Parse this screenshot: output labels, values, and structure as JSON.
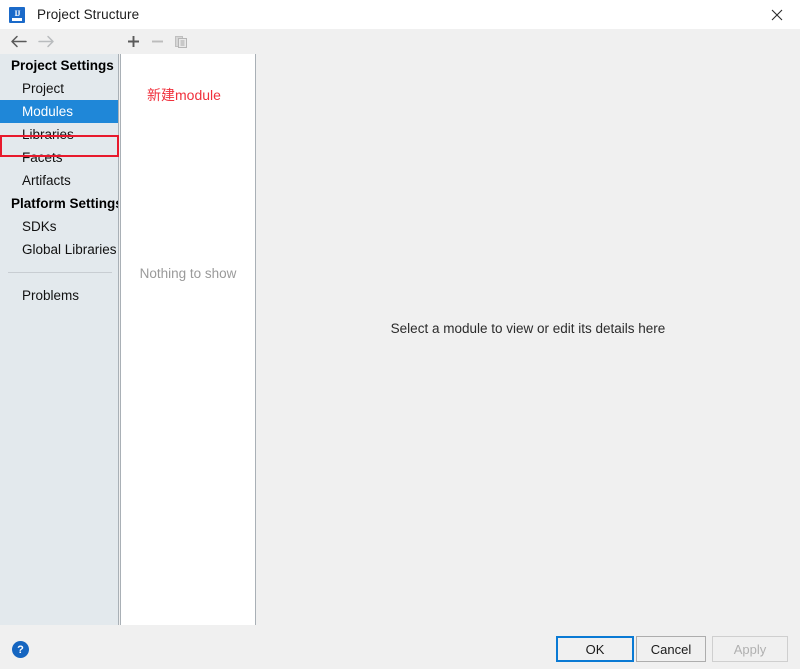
{
  "window": {
    "title": "Project Structure",
    "app_icon": "intellij-idea-icon",
    "close_label": "✕"
  },
  "navigation": {
    "back_icon": "arrow-left-icon",
    "forward_icon": "arrow-right-icon"
  },
  "sidebar": {
    "groups": [
      {
        "title": "Project Settings",
        "items": [
          {
            "label": "Project",
            "selected": false
          },
          {
            "label": "Modules",
            "selected": true
          },
          {
            "label": "Libraries",
            "selected": false
          },
          {
            "label": "Facets",
            "selected": false
          },
          {
            "label": "Artifacts",
            "selected": false
          }
        ]
      },
      {
        "title": "Platform Settings",
        "items": [
          {
            "label": "SDKs",
            "selected": false
          },
          {
            "label": "Global Libraries",
            "selected": false
          }
        ]
      }
    ],
    "problems": {
      "label": "Problems",
      "selected": false
    }
  },
  "module_panel": {
    "toolbar": {
      "add_icon": "plus-icon",
      "add_tooltip": "Add",
      "remove_icon": "minus-icon",
      "remove_tooltip": "Remove",
      "copy_icon": "copy-icon",
      "copy_tooltip": "Copy"
    },
    "annotation_label": "新建module",
    "empty_text": "Nothing to show"
  },
  "detail_pane": {
    "placeholder": "Select a module to view or edit its details here"
  },
  "footer": {
    "help_icon": "question-mark-icon",
    "help_label": "?",
    "ok_label": "OK",
    "cancel_label": "Cancel",
    "apply_label": "Apply"
  },
  "colors": {
    "selection_blue": "#1f87d8",
    "annotation_red": "#e8192c",
    "annotation_text_red": "#f0303c",
    "sidebar_bg": "#e3e9ed",
    "dialog_bg": "#f0f0f0",
    "focus_border": "#0a7ad4"
  }
}
